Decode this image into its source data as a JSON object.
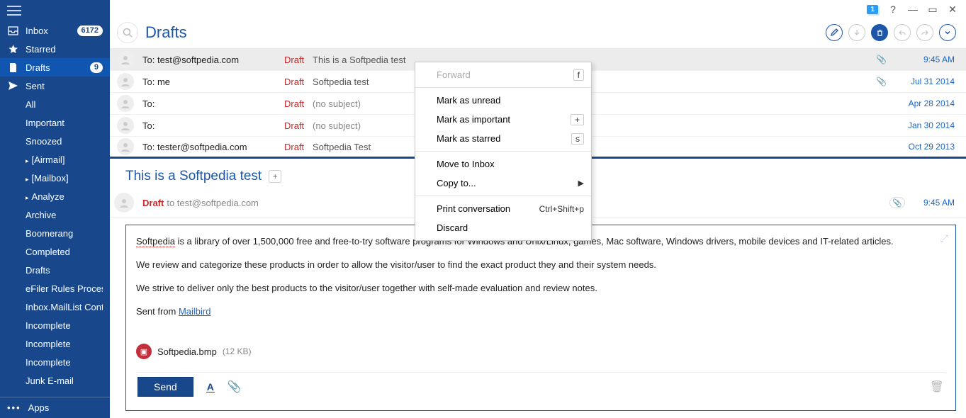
{
  "window": {
    "notif_count": "1",
    "help": "?",
    "minimize": "—",
    "maximize": "▭",
    "close": "✕"
  },
  "sidebar": {
    "items": [
      {
        "icon": "inbox",
        "label": "Inbox",
        "badge": "6172"
      },
      {
        "icon": "star",
        "label": "Starred"
      },
      {
        "icon": "draft",
        "label": "Drafts",
        "badge": "9",
        "selected": true
      },
      {
        "icon": "sent",
        "label": "Sent"
      },
      {
        "sub": true,
        "label": "All"
      },
      {
        "sub": true,
        "label": "Important"
      },
      {
        "sub": true,
        "label": "Snoozed"
      },
      {
        "sub": true,
        "expand": true,
        "label": "[Airmail]"
      },
      {
        "sub": true,
        "expand": true,
        "label": "[Mailbox]"
      },
      {
        "sub": true,
        "expand": true,
        "label": "Analyze"
      },
      {
        "sub": true,
        "label": "Archive"
      },
      {
        "sub": true,
        "label": "Boomerang"
      },
      {
        "sub": true,
        "label": "Completed"
      },
      {
        "sub": true,
        "label": "Drafts"
      },
      {
        "sub": true,
        "label": "eFiler Rules Process"
      },
      {
        "sub": true,
        "label": "Inbox.MailList Cont"
      },
      {
        "sub": true,
        "label": "Incomplete"
      },
      {
        "sub": true,
        "label": "Incomplete"
      },
      {
        "sub": true,
        "label": "Incomplete"
      },
      {
        "sub": true,
        "label": "Junk E-mail"
      }
    ],
    "apps_label": "Apps"
  },
  "header": {
    "folder_title": "Drafts"
  },
  "messages": [
    {
      "to": "To: test@softpedia.com",
      "tag": "Draft",
      "subject": "This is a Softpedia test",
      "clip": true,
      "date": "9:45 AM",
      "selected": true
    },
    {
      "to": "To: me",
      "tag": "Draft",
      "subject": "Softpedia test",
      "clip": true,
      "date": "Jul 31 2014"
    },
    {
      "to": "To:",
      "tag": "Draft",
      "subject": "(no subject)",
      "none": true,
      "date": "Apr 28 2014"
    },
    {
      "to": "To:",
      "tag": "Draft",
      "subject": "(no subject)",
      "none": true,
      "date": "Jan 30 2014"
    },
    {
      "to": "To: tester@softpedia.com",
      "tag": "Draft",
      "subject": "Softpedia Test",
      "date": "Oct 29 2013",
      "last": true
    }
  ],
  "preview": {
    "title": "This is a Softpedia test",
    "tag": "Draft",
    "to": "to test@softpedia.com",
    "time": "9:45 AM",
    "body_lead_word": "Softpedia",
    "body_p1_rest": " is a library of over 1,500,000 free and free-to-try software programs for Windows and Unix/Linux, games, Mac software, Windows drivers, mobile devices and IT-related articles.",
    "body_p2": "We review and categorize these products in order to allow the visitor/user to find the exact product they and their system needs.",
    "body_p3": "We strive to deliver only the best products to the visitor/user together with self-made evaluation and review notes.",
    "body_sent_prefix": "Sent from ",
    "body_sent_link": "Mailbird",
    "attachment": {
      "name": "Softpedia.bmp",
      "size": "(12 KB)"
    },
    "send_label": "Send",
    "format_label": "A"
  },
  "context_menu": [
    {
      "label": "Forward",
      "key": "f",
      "disabled": true,
      "type": "key"
    },
    {
      "sep": true
    },
    {
      "label": "Mark as unread"
    },
    {
      "label": "Mark as important",
      "key": "+",
      "type": "key"
    },
    {
      "label": "Mark as starred",
      "key": "s",
      "type": "key"
    },
    {
      "sep": true
    },
    {
      "label": "Move to Inbox"
    },
    {
      "label": "Copy to...",
      "submenu": true
    },
    {
      "sep": true
    },
    {
      "label": "Print conversation",
      "shortcut": "Ctrl+Shift+p"
    },
    {
      "label": "Discard"
    }
  ]
}
